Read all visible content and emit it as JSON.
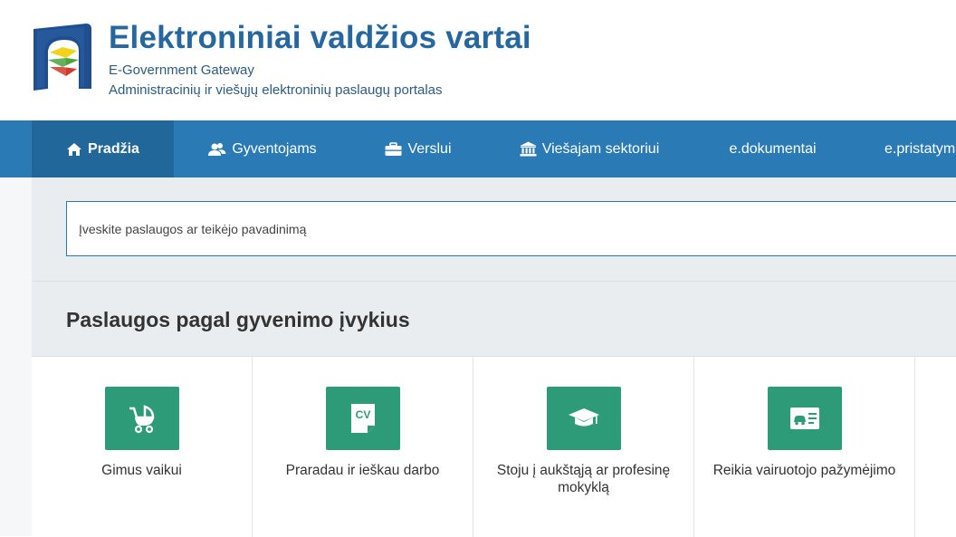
{
  "header": {
    "title": "Elektroniniai valdžios vartai",
    "subtitle_en": "E-Government Gateway",
    "subtitle_lt": "Administracinių ir viešųjų elektroninių paslaugų portalas",
    "brand_color": "#25679e"
  },
  "nav": {
    "items": [
      {
        "label": "Pradžia",
        "icon": "home-icon",
        "active": true
      },
      {
        "label": "Gyventojams",
        "icon": "users-icon"
      },
      {
        "label": "Verslui",
        "icon": "briefcase-icon"
      },
      {
        "label": "Viešajam sektoriui",
        "icon": "institution-icon"
      },
      {
        "label": "e.dokumentai"
      },
      {
        "label": "e.pristatym"
      }
    ],
    "background": "#2a7ab5",
    "active_background": "#22679a"
  },
  "search": {
    "placeholder": "Įveskite paslaugos ar teikėjo pavadinimą",
    "value": ""
  },
  "life_events": {
    "title": "Paslaugos pagal gyvenimo įvykius",
    "cards": [
      {
        "label": "Gimus vaikui",
        "icon": "baby-stroller-icon"
      },
      {
        "label": "Praradau ir ieškau darbo",
        "icon": "cv-icon"
      },
      {
        "label": "Stoju į aukštąją ar profesinę mokyklą",
        "icon": "graduation-cap-icon"
      },
      {
        "label": "Reikia vairuotojo pažymėjimo",
        "icon": "driver-license-icon"
      }
    ],
    "icon_color": "#2e9b78"
  }
}
